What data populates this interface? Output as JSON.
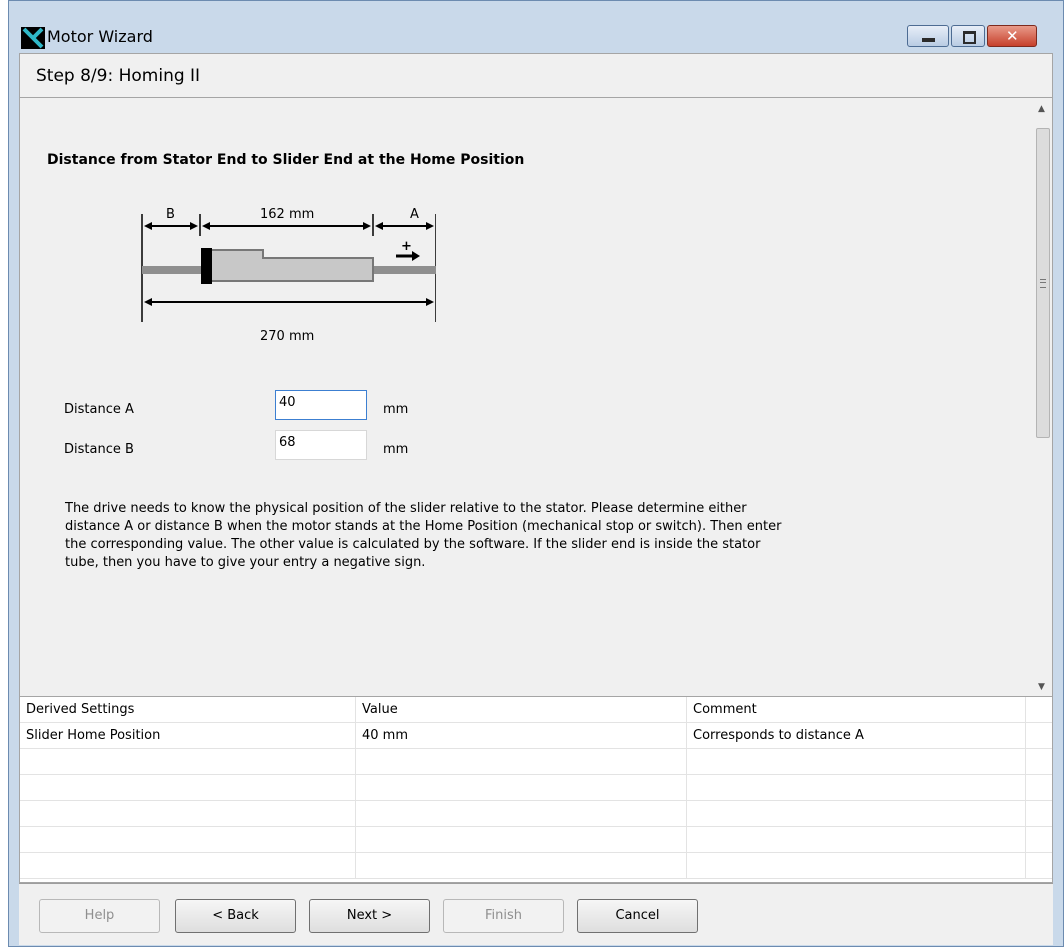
{
  "window": {
    "title": "Motor Wizard",
    "icon": "app-logo-icon"
  },
  "step": {
    "title": "Step 8/9: Homing II"
  },
  "section": {
    "title": "Distance from Stator End to Slider End at the Home Position"
  },
  "diagram": {
    "label_b": "B",
    "label_a": "A",
    "slider_length": "162 mm",
    "total_length": "270 mm",
    "direction_sign": "+"
  },
  "fields": {
    "distance_a": {
      "label": "Distance A",
      "value": "40",
      "unit": "mm"
    },
    "distance_b": {
      "label": "Distance B",
      "value": "68",
      "unit": "mm"
    }
  },
  "description": "The drive needs to know the physical position of the slider relative to the stator. Please determine either distance A or distance B when the motor stands at the Home Position (mechanical stop or switch). Then enter the corresponding value. The other value is calculated by the software. If the slider end is inside the stator tube, then you have to give your entry a negative sign.",
  "table": {
    "headers": [
      "Derived Settings",
      "Value",
      "Comment"
    ],
    "rows": [
      [
        "Slider Home Position",
        "40 mm",
        "Corresponds to distance A"
      ]
    ]
  },
  "buttons": {
    "help": "Help",
    "back": "< Back",
    "next": "Next >",
    "finish": "Finish",
    "cancel": "Cancel"
  },
  "colors": {
    "accent": "#3c7fd1",
    "close_button": "#c6402b",
    "frame": "#c9d9ea"
  }
}
